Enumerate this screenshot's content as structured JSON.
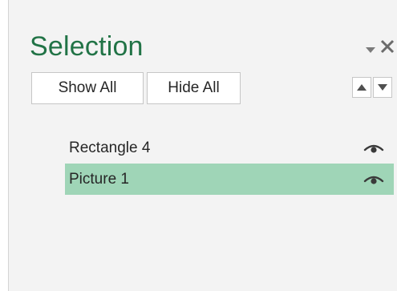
{
  "selection_pane": {
    "title": "Selection",
    "show_all_label": "Show All",
    "hide_all_label": "Hide All",
    "options_icon": "chevron-down-icon",
    "close_icon": "close-icon",
    "move_up_icon": "triangle-up-icon",
    "move_down_icon": "triangle-down-icon",
    "shapes": [
      {
        "name": "Rectangle 4",
        "selected": false,
        "visible": true,
        "visibility_icon": "eye-icon"
      },
      {
        "name": "Picture 1",
        "selected": true,
        "visible": true,
        "visibility_icon": "eye-icon"
      }
    ]
  },
  "colors": {
    "accent_green": "#217346",
    "selected_row": "#9fd5b7",
    "pane_background": "#f3f3f3"
  }
}
